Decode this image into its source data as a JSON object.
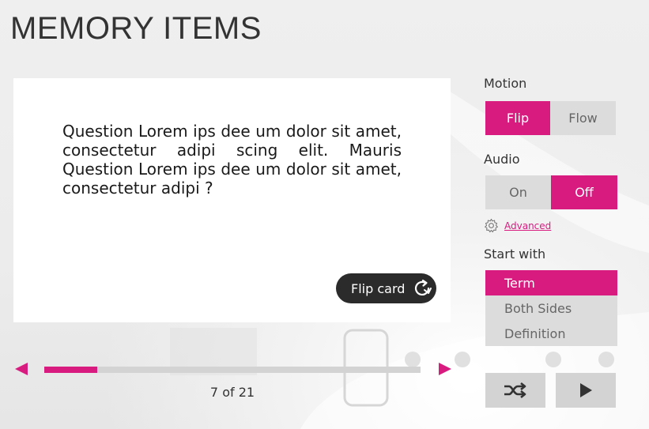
{
  "title": "MEMORY ITEMS",
  "card": {
    "question": "Question Lorem ips dee um dolor sit amet, consectetur adipi scing elit. Mauris Question Lorem ips dee um dolor sit amet, consectetur adipi ?",
    "flip_label": "Flip card",
    "flip_icon": "rotate-icon"
  },
  "navigation": {
    "current": 7,
    "total": 21,
    "counter_text": "7 of 21",
    "progress": 0.14
  },
  "motion": {
    "label": "Motion",
    "options": [
      "Flip",
      "Flow"
    ],
    "selected": "Flip"
  },
  "audio": {
    "label": "Audio",
    "options": [
      "On",
      "Off"
    ],
    "selected": "Off"
  },
  "advanced": {
    "label": "Advanced",
    "icon": "gear-icon"
  },
  "start_with": {
    "label": "Start with",
    "options": [
      "Term",
      "Both Sides",
      "Definition"
    ],
    "selected": "Term"
  },
  "controls": {
    "shuffle_icon": "shuffle-icon",
    "play_icon": "play-icon"
  },
  "colors": {
    "accent": "#d81b7f",
    "inactive": "#dcdcdc",
    "button_dark": "#2b2b2b"
  }
}
